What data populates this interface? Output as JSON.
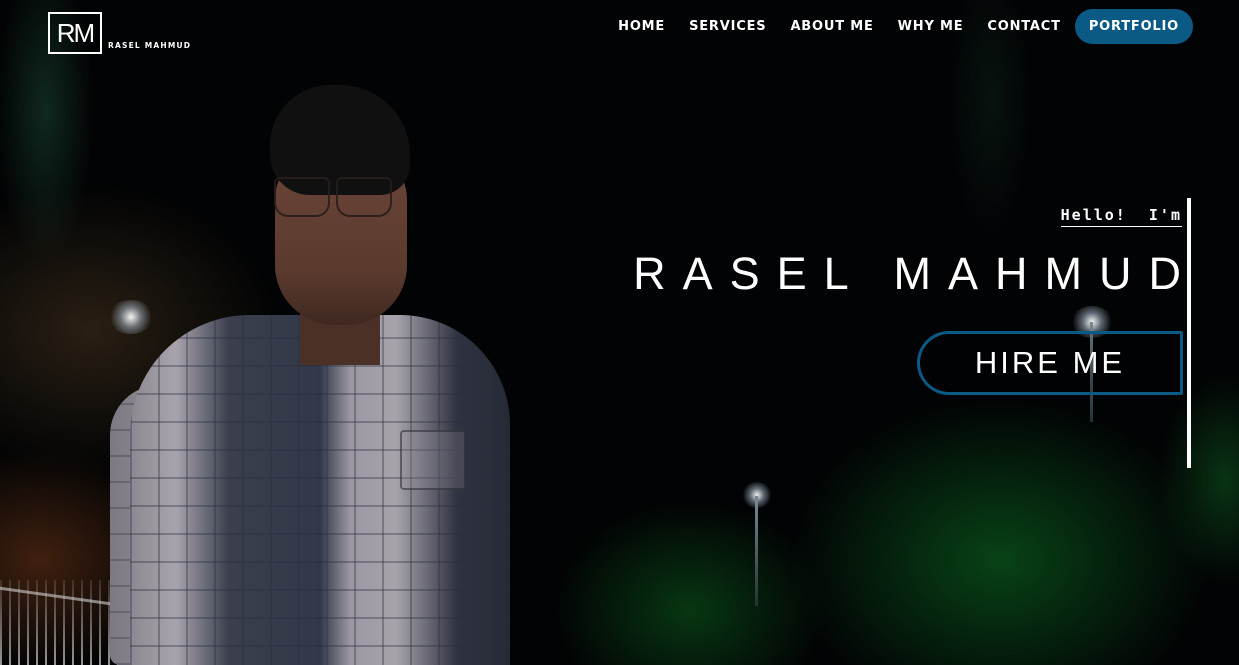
{
  "logo": {
    "mark": "RM",
    "text": "RASEL MAHMUD"
  },
  "nav": {
    "items": [
      {
        "label": "HOME"
      },
      {
        "label": "SERVICES"
      },
      {
        "label": "ABOUT ME"
      },
      {
        "label": "WHY ME"
      },
      {
        "label": "CONTACT"
      },
      {
        "label": "PORTFOLIO",
        "active": true
      }
    ]
  },
  "hero": {
    "greeting": "Hello!  I'm",
    "name": "RASEL MAHMUD",
    "cta_label": "HIRE ME"
  },
  "colors": {
    "accent": "#0b5a85",
    "background": "#020304",
    "text": "#ffffff"
  }
}
